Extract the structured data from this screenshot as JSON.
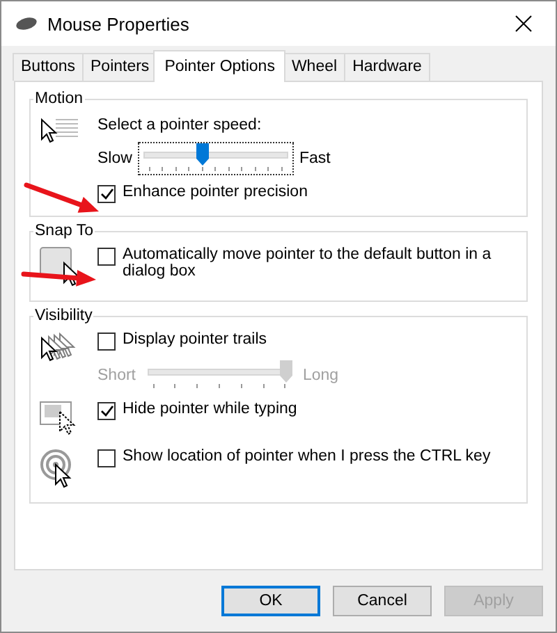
{
  "window": {
    "title": "Mouse Properties"
  },
  "tabs": [
    {
      "label": "Buttons",
      "selected": false
    },
    {
      "label": "Pointers",
      "selected": false
    },
    {
      "label": "Pointer Options",
      "selected": true
    },
    {
      "label": "Wheel",
      "selected": false
    },
    {
      "label": "Hardware",
      "selected": false
    }
  ],
  "groups": [
    {
      "title": "Motion",
      "sections": [
        {
          "kind": "speed",
          "rows": [
            {
              "kind": "label",
              "text": "Select a pointer speed:"
            },
            {
              "kind": "slider",
              "min_label": "Slow",
              "max_label": "Fast",
              "level": 0.4,
              "disabled": false,
              "focused": true
            },
            {
              "kind": "checkbox",
              "label": "Enhance pointer precision",
              "checked": true
            }
          ]
        }
      ]
    },
    {
      "title": "Snap To",
      "sections": [
        {
          "kind": "snap",
          "rows": [
            {
              "kind": "checkbox",
              "label": "Automatically move pointer to the default button in a dialog box",
              "checked": false
            }
          ]
        }
      ]
    },
    {
      "title": "Visibility",
      "sections": [
        {
          "kind": "trails",
          "rows": [
            {
              "kind": "checkbox",
              "label": "Display pointer trails",
              "checked": false
            },
            {
              "kind": "slider",
              "min_label": "Short",
              "max_label": "Long",
              "level": 1,
              "disabled": true,
              "focused": false
            }
          ]
        },
        {
          "kind": "hide",
          "rows": [
            {
              "kind": "checkbox",
              "label": "Hide pointer while typing",
              "checked": true
            }
          ]
        },
        {
          "kind": "locate",
          "rows": [
            {
              "kind": "checkbox",
              "label": "Show location of pointer when I press the CTRL key",
              "checked": false
            }
          ]
        }
      ]
    }
  ],
  "buttons": [
    {
      "label": "OK",
      "default": true,
      "disabled": false
    },
    {
      "label": "Cancel",
      "default": false,
      "disabled": false
    },
    {
      "label": "Apply",
      "default": false,
      "disabled": true
    }
  ],
  "annotations": [
    {
      "kind": "arrow"
    },
    {
      "kind": "arrow"
    }
  ]
}
